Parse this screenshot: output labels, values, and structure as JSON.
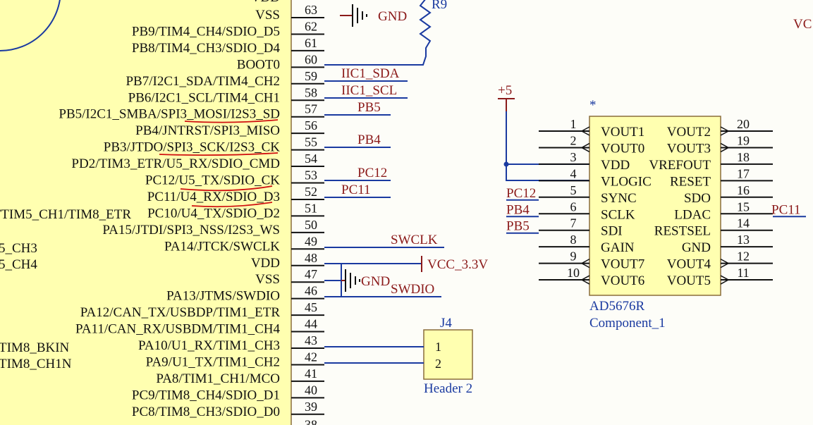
{
  "mcu": {
    "labels": [
      {
        "pin": "63",
        "name": "VSS"
      },
      {
        "pin": "62",
        "name": "PB9/TIM4_CH4/SDIO_D5"
      },
      {
        "pin": "61",
        "name": "PB8/TIM4_CH3/SDIO_D4"
      },
      {
        "pin": "60",
        "name": "BOOT0"
      },
      {
        "pin": "59",
        "name": "PB7/I2C1_SDA/TIM4_CH2"
      },
      {
        "pin": "58",
        "name": "PB6/I2C1_SCL/TIM4_CH1"
      },
      {
        "pin": "57",
        "name": "PB5/I2C1_SMBA/SPI3_MOSI/I2S3_SD"
      },
      {
        "pin": "56",
        "name": "PB4/JNTRST/SPI3_MISO"
      },
      {
        "pin": "55",
        "name": "PB3/JTDO/SPI3_SCK/I2S3_CK"
      },
      {
        "pin": "54",
        "name": "PD2/TIM3_ETR/U5_RX/SDIO_CMD"
      },
      {
        "pin": "53",
        "name": "PC12/U5_TX/SDIO_CK"
      },
      {
        "pin": "52",
        "name": "PC11/U4_RX/SDIO_D3"
      },
      {
        "pin": "51",
        "name": "PC10/U4_TX/SDIO_D2"
      },
      {
        "pin": "50",
        "name": "PA15/JTDI/SPI3_NSS/I2S3_WS"
      },
      {
        "pin": "49",
        "name": "PA14/JTCK/SWCLK"
      },
      {
        "pin": "48",
        "name": "VDD"
      },
      {
        "pin": "47",
        "name": "VSS"
      },
      {
        "pin": "46",
        "name": "PA13/JTMS/SWDIO"
      },
      {
        "pin": "45",
        "name": "PA12/CAN_TX/USBDP/TIM1_ETR"
      },
      {
        "pin": "44",
        "name": "PA11/CAN_RX/USBDM/TIM1_CH4"
      },
      {
        "pin": "43",
        "name": "PA10/U1_RX/TIM1_CH3"
      },
      {
        "pin": "42",
        "name": "PA9/U1_TX/TIM1_CH2"
      },
      {
        "pin": "41",
        "name": "PA8/TIM1_CH1/MCO"
      },
      {
        "pin": "40",
        "name": "PC9/TIM8_CH4/SDIO_D1"
      },
      {
        "pin": "39",
        "name": "PC8/TIM8_CH3/SDIO_D0"
      }
    ],
    "top_cut": "VDD",
    "left_fragments": [
      "/TIM5_CH1/TIM8_ETR",
      "5_CH3",
      "5_CH4",
      "TIM8_BKIN",
      "TIM8_CH1N"
    ],
    "bottom_pin": "38"
  },
  "nets": {
    "iic_sda": "IIC1_SDA",
    "iic_scl": "IIC1_SCL",
    "pb5": "PB5",
    "pb4": "PB4",
    "pc12": "PC12",
    "pc11": "PC11",
    "swclk": "SWCLK",
    "swdio": "SWDIO",
    "vcc33": "VCC_3.3V",
    "gnd": "GND",
    "r9": "R9",
    "vc": "VC",
    "plus5": "+5"
  },
  "dac": {
    "name": "AD5676R",
    "comment": "Component_1",
    "star": "*",
    "left_pins": [
      {
        "num": "1",
        "name": "VOUT1"
      },
      {
        "num": "2",
        "name": "VOUT0"
      },
      {
        "num": "3",
        "name": "VDD"
      },
      {
        "num": "4",
        "name": "VLOGIC"
      },
      {
        "num": "5",
        "name": "SYNC"
      },
      {
        "num": "6",
        "name": "SCLK"
      },
      {
        "num": "7",
        "name": "SDI"
      },
      {
        "num": "8",
        "name": "GAIN"
      },
      {
        "num": "9",
        "name": "VOUT7"
      },
      {
        "num": "10",
        "name": "VOUT6"
      }
    ],
    "right_pins": [
      {
        "num": "20",
        "name": "VOUT2"
      },
      {
        "num": "19",
        "name": "VOUT3"
      },
      {
        "num": "18",
        "name": "VREFOUT"
      },
      {
        "num": "17",
        "name": "RESET"
      },
      {
        "num": "16",
        "name": "SDO"
      },
      {
        "num": "15",
        "name": "LDAC"
      },
      {
        "num": "14",
        "name": "RESTSEL"
      },
      {
        "num": "13",
        "name": "GND"
      },
      {
        "num": "12",
        "name": "VOUT4"
      },
      {
        "num": "11",
        "name": "VOUT5"
      }
    ],
    "left_nets": {
      "5": "PC12",
      "6": "PB4",
      "7": "PB5"
    },
    "right_nets": {
      "15": "PC11"
    }
  },
  "header": {
    "ref": "J4",
    "name": "Header 2",
    "pins": [
      "1",
      "2"
    ]
  }
}
